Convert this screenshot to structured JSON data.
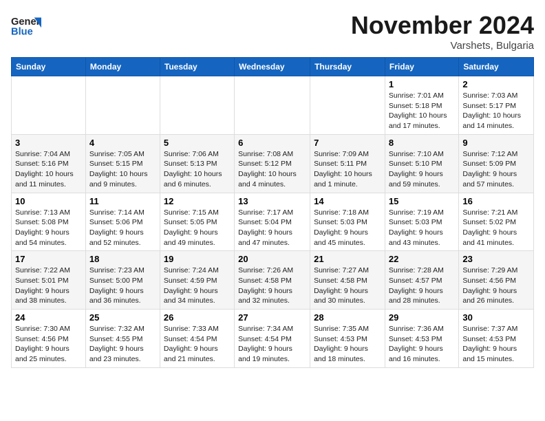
{
  "header": {
    "logo_general": "General",
    "logo_blue": "Blue",
    "month": "November 2024",
    "location": "Varshets, Bulgaria"
  },
  "days_of_week": [
    "Sunday",
    "Monday",
    "Tuesday",
    "Wednesday",
    "Thursday",
    "Friday",
    "Saturday"
  ],
  "weeks": [
    [
      {
        "day": "",
        "info": ""
      },
      {
        "day": "",
        "info": ""
      },
      {
        "day": "",
        "info": ""
      },
      {
        "day": "",
        "info": ""
      },
      {
        "day": "",
        "info": ""
      },
      {
        "day": "1",
        "info": "Sunrise: 7:01 AM\nSunset: 5:18 PM\nDaylight: 10 hours and 17 minutes."
      },
      {
        "day": "2",
        "info": "Sunrise: 7:03 AM\nSunset: 5:17 PM\nDaylight: 10 hours and 14 minutes."
      }
    ],
    [
      {
        "day": "3",
        "info": "Sunrise: 7:04 AM\nSunset: 5:16 PM\nDaylight: 10 hours and 11 minutes."
      },
      {
        "day": "4",
        "info": "Sunrise: 7:05 AM\nSunset: 5:15 PM\nDaylight: 10 hours and 9 minutes."
      },
      {
        "day": "5",
        "info": "Sunrise: 7:06 AM\nSunset: 5:13 PM\nDaylight: 10 hours and 6 minutes."
      },
      {
        "day": "6",
        "info": "Sunrise: 7:08 AM\nSunset: 5:12 PM\nDaylight: 10 hours and 4 minutes."
      },
      {
        "day": "7",
        "info": "Sunrise: 7:09 AM\nSunset: 5:11 PM\nDaylight: 10 hours and 1 minute."
      },
      {
        "day": "8",
        "info": "Sunrise: 7:10 AM\nSunset: 5:10 PM\nDaylight: 9 hours and 59 minutes."
      },
      {
        "day": "9",
        "info": "Sunrise: 7:12 AM\nSunset: 5:09 PM\nDaylight: 9 hours and 57 minutes."
      }
    ],
    [
      {
        "day": "10",
        "info": "Sunrise: 7:13 AM\nSunset: 5:08 PM\nDaylight: 9 hours and 54 minutes."
      },
      {
        "day": "11",
        "info": "Sunrise: 7:14 AM\nSunset: 5:06 PM\nDaylight: 9 hours and 52 minutes."
      },
      {
        "day": "12",
        "info": "Sunrise: 7:15 AM\nSunset: 5:05 PM\nDaylight: 9 hours and 49 minutes."
      },
      {
        "day": "13",
        "info": "Sunrise: 7:17 AM\nSunset: 5:04 PM\nDaylight: 9 hours and 47 minutes."
      },
      {
        "day": "14",
        "info": "Sunrise: 7:18 AM\nSunset: 5:03 PM\nDaylight: 9 hours and 45 minutes."
      },
      {
        "day": "15",
        "info": "Sunrise: 7:19 AM\nSunset: 5:03 PM\nDaylight: 9 hours and 43 minutes."
      },
      {
        "day": "16",
        "info": "Sunrise: 7:21 AM\nSunset: 5:02 PM\nDaylight: 9 hours and 41 minutes."
      }
    ],
    [
      {
        "day": "17",
        "info": "Sunrise: 7:22 AM\nSunset: 5:01 PM\nDaylight: 9 hours and 38 minutes."
      },
      {
        "day": "18",
        "info": "Sunrise: 7:23 AM\nSunset: 5:00 PM\nDaylight: 9 hours and 36 minutes."
      },
      {
        "day": "19",
        "info": "Sunrise: 7:24 AM\nSunset: 4:59 PM\nDaylight: 9 hours and 34 minutes."
      },
      {
        "day": "20",
        "info": "Sunrise: 7:26 AM\nSunset: 4:58 PM\nDaylight: 9 hours and 32 minutes."
      },
      {
        "day": "21",
        "info": "Sunrise: 7:27 AM\nSunset: 4:58 PM\nDaylight: 9 hours and 30 minutes."
      },
      {
        "day": "22",
        "info": "Sunrise: 7:28 AM\nSunset: 4:57 PM\nDaylight: 9 hours and 28 minutes."
      },
      {
        "day": "23",
        "info": "Sunrise: 7:29 AM\nSunset: 4:56 PM\nDaylight: 9 hours and 26 minutes."
      }
    ],
    [
      {
        "day": "24",
        "info": "Sunrise: 7:30 AM\nSunset: 4:56 PM\nDaylight: 9 hours and 25 minutes."
      },
      {
        "day": "25",
        "info": "Sunrise: 7:32 AM\nSunset: 4:55 PM\nDaylight: 9 hours and 23 minutes."
      },
      {
        "day": "26",
        "info": "Sunrise: 7:33 AM\nSunset: 4:54 PM\nDaylight: 9 hours and 21 minutes."
      },
      {
        "day": "27",
        "info": "Sunrise: 7:34 AM\nSunset: 4:54 PM\nDaylight: 9 hours and 19 minutes."
      },
      {
        "day": "28",
        "info": "Sunrise: 7:35 AM\nSunset: 4:53 PM\nDaylight: 9 hours and 18 minutes."
      },
      {
        "day": "29",
        "info": "Sunrise: 7:36 AM\nSunset: 4:53 PM\nDaylight: 9 hours and 16 minutes."
      },
      {
        "day": "30",
        "info": "Sunrise: 7:37 AM\nSunset: 4:53 PM\nDaylight: 9 hours and 15 minutes."
      }
    ]
  ]
}
